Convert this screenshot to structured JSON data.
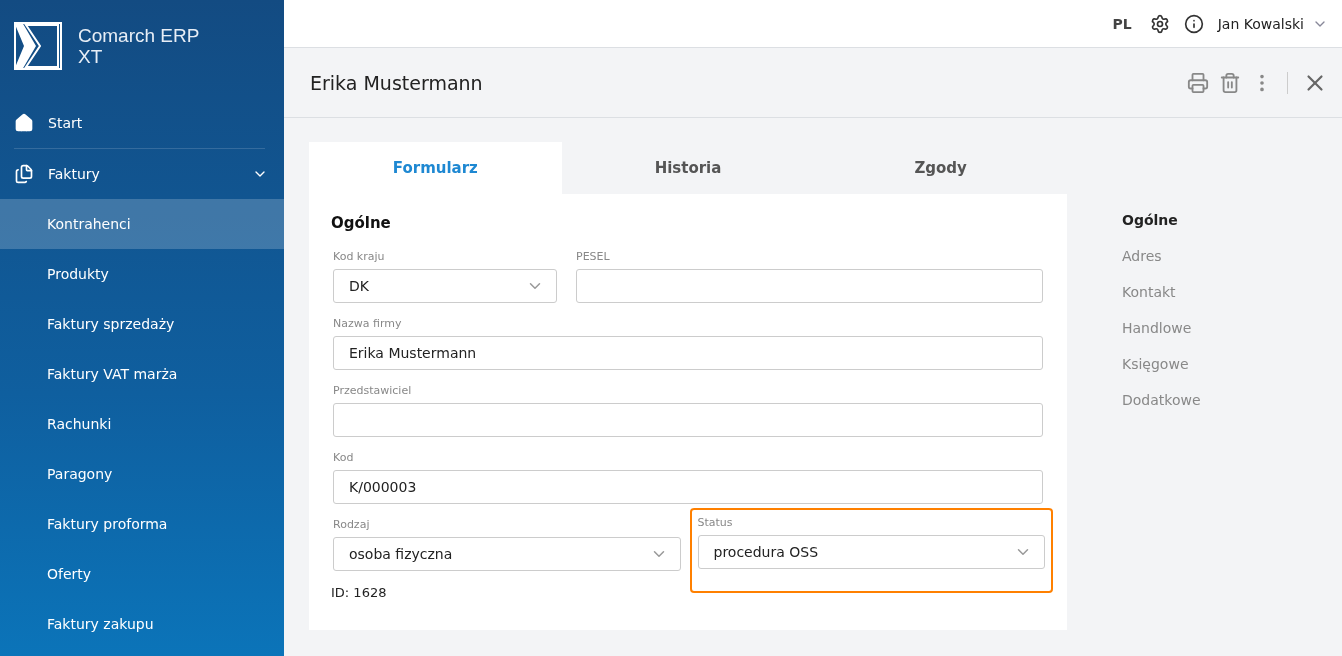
{
  "brand": {
    "name": "Comarch ERP XT"
  },
  "sidebar": {
    "items": [
      {
        "label": "Start",
        "kind": "home",
        "selected": false
      },
      {
        "label": "Faktury",
        "kind": "docs",
        "selected": false,
        "expanded": true,
        "children": [
          {
            "label": "Kontrahenci",
            "selected": true
          },
          {
            "label": "Produkty",
            "selected": false
          },
          {
            "label": "Faktury sprzedaży",
            "selected": false
          },
          {
            "label": "Faktury VAT marża",
            "selected": false
          },
          {
            "label": "Rachunki",
            "selected": false
          },
          {
            "label": "Paragony",
            "selected": false
          },
          {
            "label": "Faktury proforma",
            "selected": false
          },
          {
            "label": "Oferty",
            "selected": false
          },
          {
            "label": "Faktury zakupu",
            "selected": false
          }
        ]
      }
    ]
  },
  "topbar": {
    "language": "PL",
    "user": "Jan Kowalski"
  },
  "record": {
    "title": "Erika Mustermann"
  },
  "tabs": [
    {
      "label": "Formularz",
      "selected": true
    },
    {
      "label": "Historia",
      "selected": false
    },
    {
      "label": "Zgody",
      "selected": false
    }
  ],
  "form": {
    "section": "Ogólne",
    "rows": [
      [
        {
          "kind": "select",
          "label": "Kod kraju",
          "value": "DK",
          "highlighted": false,
          "narrow": true
        },
        {
          "kind": "text",
          "label": "PESEL",
          "highlighted": false,
          "narrow": false
        }
      ],
      [
        {
          "kind": "text",
          "label": "Nazwa firmy",
          "value": "Erika Mustermann",
          "highlighted": false
        }
      ],
      [
        {
          "kind": "text",
          "label": "Przedstawiciel",
          "highlighted": false
        }
      ],
      [
        {
          "kind": "text",
          "label": "Kod",
          "value": "K/000003",
          "highlighted": false
        }
      ],
      [
        {
          "kind": "select",
          "label": "Rodzaj",
          "value": "osoba fizyczna",
          "highlighted": false
        },
        {
          "kind": "select",
          "label": "Status",
          "value": "procedura OSS",
          "highlighted": true
        }
      ]
    ],
    "id_text": "ID: 1628"
  },
  "section_nav": [
    {
      "label": "Ogólne",
      "selected": true
    },
    {
      "label": "Adres",
      "selected": false
    },
    {
      "label": "Kontakt",
      "selected": false
    },
    {
      "label": "Handlowe",
      "selected": false
    },
    {
      "label": "Księgowe",
      "selected": false
    },
    {
      "label": "Dodatkowe",
      "selected": false
    }
  ]
}
